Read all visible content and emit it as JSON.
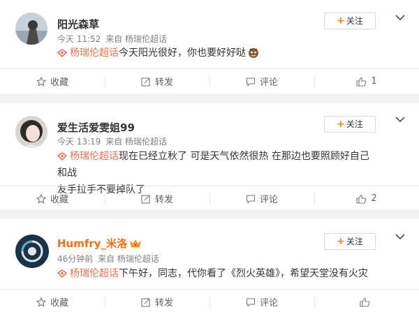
{
  "posts": [
    {
      "user_name": "阳光森草",
      "meta_time": "今天 11:52",
      "meta_source": "来自 杨瑞伦超话",
      "tag": "杨瑞伦超话",
      "text": "今天阳光很好，你也要好好哒",
      "follow_label": "关注",
      "actions": {
        "favorite": "收藏",
        "repost": "转发",
        "comment": "评论",
        "like": "1"
      }
    },
    {
      "user_name": "爱生活爱雯姐99",
      "meta_time": "今天 13:19",
      "meta_source": "来自 杨瑞伦超话",
      "tag": "杨瑞伦超话",
      "text": "现在已经立秋了 可是天气依然很热  在那边也要照顾好自己  和战",
      "text_line2": "友手拉手不要掉队了",
      "follow_label": "关注",
      "actions": {
        "favorite": "收藏",
        "repost": "转发",
        "comment": "评论",
        "like": "2"
      }
    },
    {
      "user_name": "Humfry_米洛",
      "meta_time": "46分钟前",
      "meta_source": "来自 杨瑞伦超话",
      "tag": "杨瑞伦超话",
      "text": "下午好，同志，代你看了《烈火英雄》，希望天堂没有火灾",
      "follow_label": "关注",
      "actions": {
        "favorite": "收藏",
        "repost": "转发",
        "comment": "评论",
        "like": ""
      }
    }
  ],
  "colors": {
    "accent": "#ff8200",
    "tag": "#eb7350",
    "vip_name": "#f86e0e",
    "background": "#f2f2f2"
  },
  "icons": [
    "star-icon",
    "repost-icon",
    "comment-icon",
    "thumb-up-icon",
    "chevron-down-icon",
    "supertopic-icon",
    "crown-badge-icon",
    "emoji-icon"
  ]
}
